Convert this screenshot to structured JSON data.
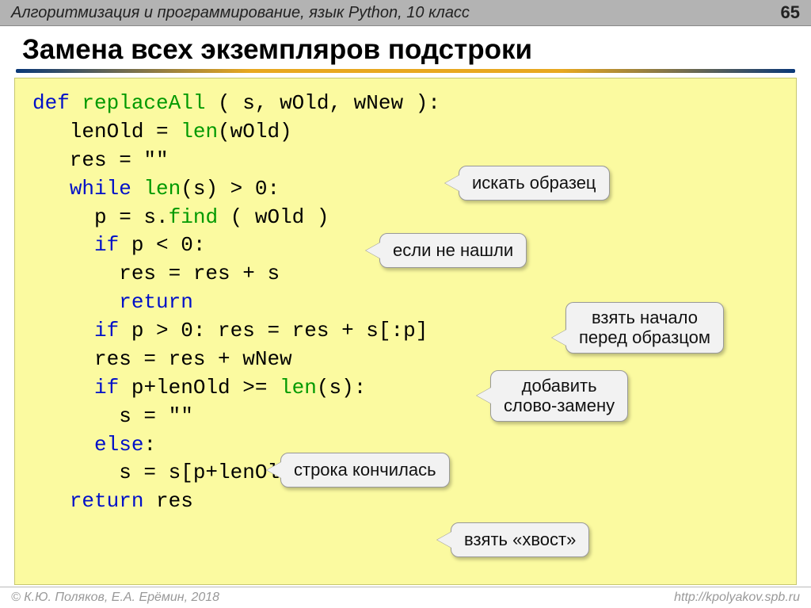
{
  "header": {
    "course": "Алгоритмизация и программирование, язык Python, 10 класс",
    "page": "65"
  },
  "title": "Замена всех экземпляров подстроки",
  "code": {
    "l1a": "def ",
    "l1b": "replaceAll",
    "l1c": " ( s, wOld, wNew ):",
    "l2a": "   lenOld = ",
    "l2b": "len",
    "l2c": "(wOld)",
    "l3": "   res = \"\"",
    "l4a": "   ",
    "l4b": "while",
    "l4c": " ",
    "l4d": "len",
    "l4e": "(s) > 0:",
    "l5a": "     p = s.",
    "l5b": "find",
    "l5c": " ( wOld )",
    "l6a": "     ",
    "l6b": "if",
    "l6c": " p < 0:",
    "l7": "       res = res + s",
    "l8a": "       ",
    "l8b": "return",
    "l9a": "     ",
    "l9b": "if",
    "l9c": " p > 0: res = res + s[:p]",
    "l10": "     res = res + wNew",
    "l11a": "     ",
    "l11b": "if",
    "l11c": " p+lenOld >= ",
    "l11d": "len",
    "l11e": "(s):",
    "l12": "       s = \"\"",
    "l13a": "     ",
    "l13b": "else",
    "l13c": ":",
    "l14": "       s = s[p+lenOld:]",
    "l15a": "   ",
    "l15b": "return",
    "l15c": " res"
  },
  "callouts": {
    "c1": "искать образец",
    "c2": "если не нашли",
    "c3": "взять начало\nперед образцом",
    "c4": "добавить\nслово-замену",
    "c5": "строка кончилась",
    "c6": "взять «хвост»"
  },
  "footer": {
    "left": "© К.Ю. Поляков, Е.А. Ерёмин, 2018",
    "right": "http://kpolyakov.spb.ru"
  }
}
